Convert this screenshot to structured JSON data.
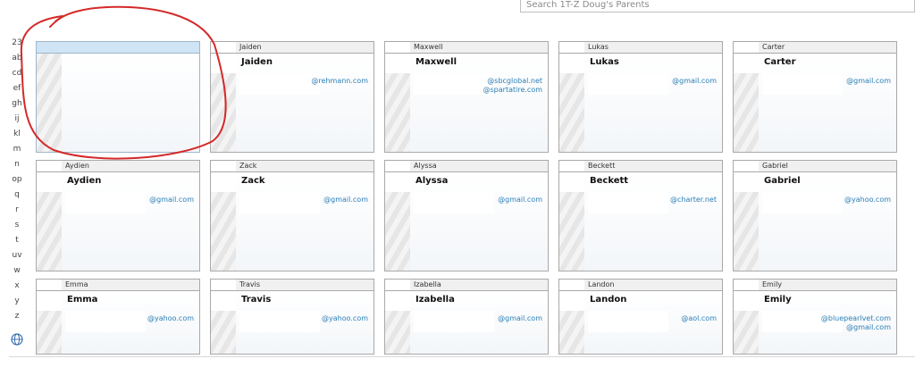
{
  "search": {
    "value": "Search 1T-Z Doug's Parents"
  },
  "index": [
    "23",
    "ab",
    "cd",
    "ef",
    "gh",
    "ij",
    "kl",
    "m",
    "n",
    "op",
    "q",
    "r",
    "s",
    "t",
    "uv",
    "w",
    "x",
    "y",
    "z"
  ],
  "contacts": [
    {
      "header": "",
      "name": "",
      "emails": [],
      "selected": true
    },
    {
      "header": "Jaiden",
      "name": "Jaiden",
      "emails": [
        "@rehmann.com"
      ],
      "selected": false
    },
    {
      "header": "Maxwell",
      "name": "Maxwell",
      "emails": [
        "@sbcglobal.net",
        "@spartatire.com"
      ],
      "selected": false
    },
    {
      "header": "Lukas",
      "name": "Lukas",
      "emails": [
        "@gmail.com"
      ],
      "selected": false
    },
    {
      "header": "Carter",
      "name": "Carter",
      "emails": [
        "@gmail.com"
      ],
      "selected": false
    },
    {
      "header": "Aydien",
      "name": "Aydien",
      "emails": [
        "@gmail.com"
      ],
      "selected": false
    },
    {
      "header": "Zack",
      "name": "Zack",
      "emails": [
        "@gmail.com"
      ],
      "selected": false
    },
    {
      "header": "Alyssa",
      "name": "Alyssa",
      "emails": [
        "@gmail.com"
      ],
      "selected": false
    },
    {
      "header": "Beckett",
      "name": "Beckett",
      "emails": [
        "@charter.net"
      ],
      "selected": false
    },
    {
      "header": "Gabriel",
      "name": "Gabriel",
      "emails": [
        "@yahoo.com"
      ],
      "selected": false
    },
    {
      "header": "Emma",
      "name": "Emma",
      "emails": [
        "@yahoo.com"
      ],
      "selected": false
    },
    {
      "header": "Travis",
      "name": "Travis",
      "emails": [
        "@yahoo.com"
      ],
      "selected": false
    },
    {
      "header": "Izabella",
      "name": "Izabella",
      "emails": [
        "@gmail.com"
      ],
      "selected": false
    },
    {
      "header": "Landon",
      "name": "Landon",
      "emails": [
        "@aol.com"
      ],
      "selected": false
    },
    {
      "header": "Emily",
      "name": "Emily",
      "emails": [
        "@bluepearlvet.com",
        "@gmail.com"
      ],
      "selected": false
    }
  ],
  "colors": {
    "selected_header": "#cfe4f4",
    "email_link": "#2b7fb6",
    "annotation": "#d42a2a"
  },
  "icons": {
    "globe": "globe-icon"
  }
}
